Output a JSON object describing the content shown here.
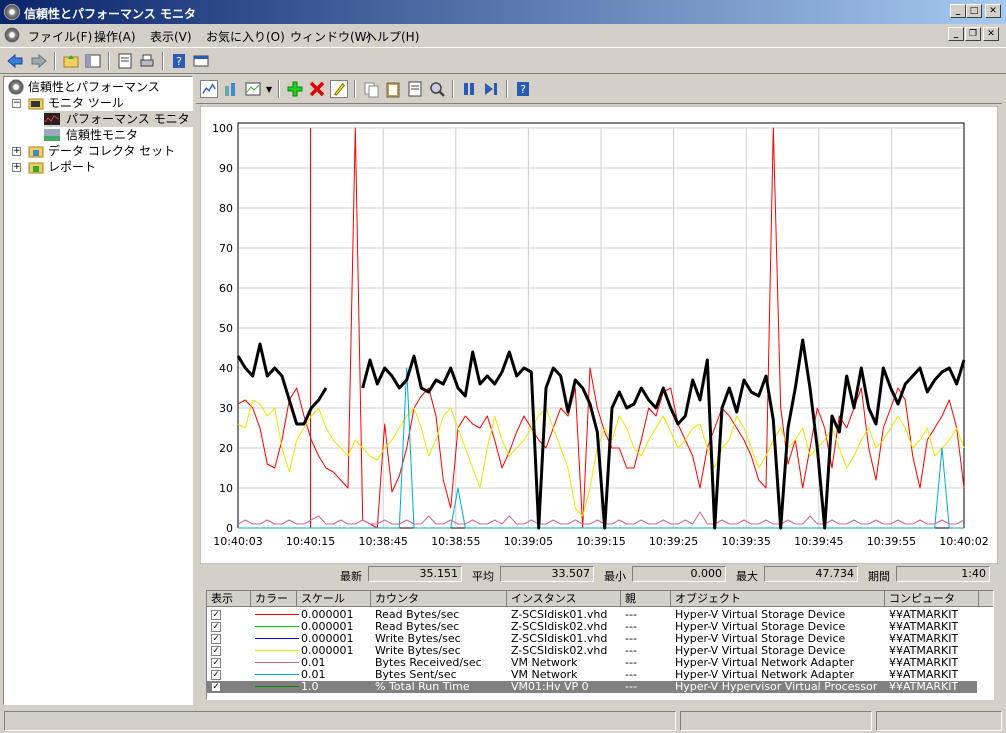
{
  "window": {
    "title": "信頼性とパフォーマンス モニタ"
  },
  "menu": [
    "ファイル(F)",
    "操作(A)",
    "表示(V)",
    "お気に入り(O)",
    "ウィンドウ(W)",
    "ヘルプ(H)"
  ],
  "tree": {
    "root": "信頼性とパフォーマンス",
    "monitor_tools": "モニタ ツール",
    "perf_monitor": "パフォーマンス モニタ",
    "reliability_monitor": "信頼性モニタ",
    "data_collector_sets": "データ コレクタ セット",
    "reports": "レポート"
  },
  "graph": {
    "y_ticks": [
      "100",
      "90",
      "80",
      "70",
      "60",
      "50",
      "40",
      "30",
      "20",
      "10",
      "0"
    ],
    "x_ticks": [
      "10:40:03",
      "10:40:15",
      "10:38:45",
      "10:38:55",
      "10:39:05",
      "10:39:15",
      "10:39:25",
      "10:39:35",
      "10:39:45",
      "10:39:55",
      "10:40:02"
    ]
  },
  "chart_data": {
    "type": "line",
    "ylim": [
      0,
      100
    ],
    "grid": true,
    "points_per_series": 100,
    "series": [
      {
        "name": "Read Bytes/sec Z-SCSIdisk01.vhd",
        "color": "#ff0000",
        "values": [
          31,
          32,
          30,
          25,
          16,
          15,
          22,
          32,
          35,
          28,
          22,
          18,
          15,
          14,
          12,
          10,
          100,
          2,
          1,
          0,
          26,
          9,
          13,
          20,
          30,
          33,
          35,
          28,
          12,
          5,
          25,
          28,
          26,
          25,
          28,
          22,
          15,
          19,
          24,
          28,
          25,
          22,
          20,
          25,
          30,
          28,
          35,
          0,
          40,
          30,
          24,
          20,
          20,
          15,
          15,
          22,
          30,
          28,
          34,
          35,
          26,
          22,
          18,
          10,
          20,
          25,
          30,
          28,
          25,
          22,
          18,
          12,
          10,
          100,
          30,
          16,
          22,
          10,
          20,
          30,
          25,
          15,
          28,
          25,
          30,
          35,
          20,
          12,
          25,
          30,
          35,
          32,
          18,
          10,
          22,
          25,
          28,
          32,
          25,
          10
        ]
      },
      {
        "name": "Write Bytes/sec Z-SCSIdisk02.vhd",
        "color": "#e8e800",
        "values": [
          26,
          25,
          32,
          31,
          28,
          30,
          20,
          14,
          22,
          25,
          28,
          30,
          25,
          22,
          20,
          18,
          22,
          20,
          18,
          17,
          20,
          22,
          25,
          28,
          30,
          25,
          18,
          22,
          28,
          30,
          25,
          20,
          15,
          10,
          20,
          28,
          22,
          18,
          20,
          22,
          25,
          28,
          30,
          25,
          20,
          15,
          5,
          3,
          10,
          20,
          25,
          22,
          28,
          25,
          20,
          18,
          22,
          25,
          28,
          24,
          20,
          22,
          25,
          26,
          20,
          15,
          20,
          22,
          28,
          25,
          20,
          15,
          18,
          22,
          25,
          20,
          22,
          25,
          18,
          20,
          22,
          25,
          20,
          15,
          18,
          22,
          25,
          20,
          22,
          25,
          28,
          25,
          20,
          22,
          25,
          18,
          20,
          22,
          25,
          20
        ]
      },
      {
        "name": "Bytes Sent/sec VM Network",
        "color": "#00aacc",
        "values": [
          0,
          0,
          0,
          0,
          0,
          0,
          0,
          0,
          0,
          0,
          0,
          0,
          0,
          0,
          0,
          0,
          0,
          0,
          0,
          0,
          0,
          0,
          0,
          40,
          0,
          0,
          0,
          0,
          0,
          0,
          10,
          0,
          0,
          0,
          0,
          0,
          0,
          0,
          0,
          0,
          0,
          0,
          0,
          0,
          0,
          0,
          0,
          0,
          0,
          0,
          0,
          0,
          0,
          0,
          0,
          0,
          0,
          0,
          0,
          0,
          0,
          0,
          0,
          0,
          0,
          0,
          0,
          0,
          0,
          0,
          0,
          0,
          0,
          0,
          0,
          0,
          0,
          0,
          0,
          0,
          0,
          0,
          0,
          0,
          0,
          0,
          0,
          0,
          0,
          0,
          0,
          0,
          0,
          0,
          0,
          0,
          20,
          0,
          0,
          0
        ]
      },
      {
        "name": "Bytes Received/sec VM Network",
        "color": "#cc6699",
        "values": [
          1,
          2,
          1,
          1,
          2,
          1,
          1,
          2,
          1,
          1,
          2,
          3,
          1,
          1,
          2,
          1,
          1,
          2,
          1,
          1,
          2,
          1,
          1,
          2,
          1,
          1,
          3,
          1,
          1,
          2,
          1,
          1,
          2,
          1,
          1,
          2,
          1,
          3,
          1,
          1,
          2,
          1,
          1,
          2,
          1,
          1,
          2,
          1,
          1,
          2,
          1,
          1,
          2,
          1,
          1,
          2,
          1,
          1,
          2,
          1,
          1,
          2,
          1,
          4,
          1,
          1,
          2,
          1,
          1,
          2,
          1,
          1,
          2,
          1,
          1,
          2,
          1,
          1,
          3,
          1,
          1,
          2,
          1,
          1,
          2,
          1,
          1,
          2,
          1,
          1,
          2,
          1,
          1,
          2,
          1,
          1,
          2,
          1,
          1,
          2
        ]
      },
      {
        "name": "% Total Run Time VM01:Hv VP 0",
        "color": "#000000",
        "values": [
          43,
          40,
          38,
          46,
          38,
          40,
          38,
          32,
          26,
          26,
          30,
          32,
          35,
          null,
          null,
          null,
          null,
          35,
          42,
          36,
          40,
          38,
          35,
          37,
          43,
          35,
          34,
          37,
          36,
          40,
          35,
          33,
          44,
          36,
          38,
          36,
          39,
          44,
          38,
          40,
          39,
          0,
          35,
          40,
          38,
          29,
          37,
          35,
          31,
          24,
          0,
          30,
          34,
          30,
          31,
          35,
          32,
          30,
          35,
          30,
          26,
          28,
          37,
          32,
          42,
          0,
          30,
          35,
          29,
          37,
          34,
          33,
          38,
          27,
          0,
          25,
          35,
          47,
          35,
          20,
          0,
          28,
          24,
          38,
          30,
          40,
          30,
          26,
          40,
          35,
          31,
          36,
          38,
          40,
          34,
          37,
          39,
          40,
          36,
          42
        ]
      }
    ]
  },
  "stats": {
    "last_label": "最新",
    "last": "35.151",
    "avg_label": "平均",
    "avg": "33.507",
    "min_label": "最小",
    "min": "0.000",
    "max_label": "最大",
    "max": "47.734",
    "dur_label": "期間",
    "dur": "1:40"
  },
  "counter_headers": [
    "表示",
    "カラー",
    "スケール",
    "カウンタ",
    "インスタンス",
    "親",
    "オブジェクト",
    "コンピュータ"
  ],
  "counters": [
    {
      "color": "#ff0000",
      "scale": "0.000001",
      "counter": "Read Bytes/sec",
      "instance": "Z-SCSIdisk01.vhd",
      "parent": "---",
      "object": "Hyper-V Virtual Storage Device",
      "computer": "¥¥ATMARKIT"
    },
    {
      "color": "#00cc00",
      "scale": "0.000001",
      "counter": "Read Bytes/sec",
      "instance": "Z-SCSIdisk02.vhd",
      "parent": "---",
      "object": "Hyper-V Virtual Storage Device",
      "computer": "¥¥ATMARKIT"
    },
    {
      "color": "#0000cc",
      "scale": "0.000001",
      "counter": "Write Bytes/sec",
      "instance": "Z-SCSIdisk01.vhd",
      "parent": "---",
      "object": "Hyper-V Virtual Storage Device",
      "computer": "¥¥ATMARKIT"
    },
    {
      "color": "#e8e800",
      "scale": "0.000001",
      "counter": "Write Bytes/sec",
      "instance": "Z-SCSIdisk02.vhd",
      "parent": "---",
      "object": "Hyper-V Virtual Storage Device",
      "computer": "¥¥ATMARKIT"
    },
    {
      "color": "#cc6699",
      "scale": "0.01",
      "counter": "Bytes Received/sec",
      "instance": "VM Network",
      "parent": "---",
      "object": "Hyper-V Virtual Network Adapter",
      "computer": "¥¥ATMARKIT"
    },
    {
      "color": "#00aacc",
      "scale": "0.01",
      "counter": "Bytes Sent/sec",
      "instance": "VM Network",
      "parent": "---",
      "object": "Hyper-V Virtual Network Adapter",
      "computer": "¥¥ATMARKIT"
    },
    {
      "color": "#008800",
      "scale": "1.0",
      "counter": "% Total Run Time",
      "instance": "VM01:Hv VP 0",
      "parent": "---",
      "object": "Hyper-V Hypervisor Virtual Processor",
      "computer": "¥¥ATMARKIT"
    }
  ]
}
